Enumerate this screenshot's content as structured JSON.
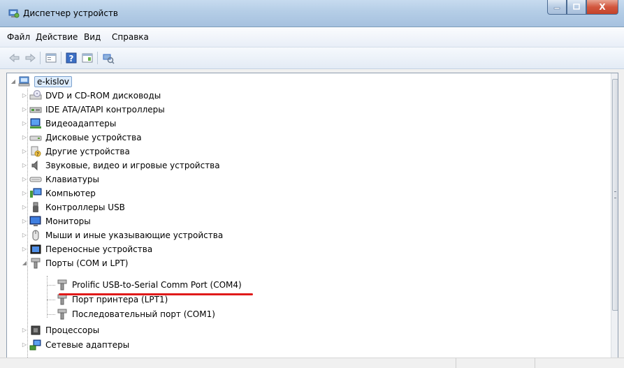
{
  "window": {
    "title": "Диспетчер устройств",
    "icon": "device-manager-icon",
    "controls": {
      "minimize": "–",
      "maximize": "□",
      "close": "X"
    }
  },
  "menu": {
    "items": [
      "Файл",
      "Действие",
      "Вид",
      "Справка"
    ]
  },
  "toolbar": {
    "icons": [
      "back-arrow-icon",
      "forward-arrow-icon",
      "properties-icon",
      "help-icon",
      "view-icon",
      "scan-hardware-icon"
    ]
  },
  "tree": {
    "root": {
      "label": "e-kislov",
      "expanded": true,
      "icon": "computer-icon"
    },
    "items": [
      {
        "label": "DVD и CD-ROM дисководы",
        "icon": "dvd-drive-icon",
        "expanded": false
      },
      {
        "label": "IDE ATA/ATAPI контроллеры",
        "icon": "ide-controller-icon",
        "expanded": false
      },
      {
        "label": "Видеоадаптеры",
        "icon": "display-adapter-icon",
        "expanded": false
      },
      {
        "label": "Дисковые устройства",
        "icon": "disk-drive-icon",
        "expanded": false
      },
      {
        "label": "Другие устройства",
        "icon": "unknown-device-icon",
        "expanded": false
      },
      {
        "label": "Звуковые, видео и игровые устройства",
        "icon": "speaker-icon",
        "expanded": false
      },
      {
        "label": "Клавиатуры",
        "icon": "keyboard-icon",
        "expanded": false
      },
      {
        "label": "Компьютер",
        "icon": "computer-icon",
        "expanded": false
      },
      {
        "label": "Контроллеры USB",
        "icon": "usb-icon",
        "expanded": false
      },
      {
        "label": "Мониторы",
        "icon": "monitor-icon",
        "expanded": false
      },
      {
        "label": "Мыши и иные указывающие устройства",
        "icon": "mouse-icon",
        "expanded": false
      },
      {
        "label": "Переносные устройства",
        "icon": "portable-device-icon",
        "expanded": false
      },
      {
        "label": "Порты (COM и LPT)",
        "icon": "port-icon",
        "expanded": true
      },
      {
        "label": "Prolific USB-to-Serial Comm Port (COM4)",
        "icon": "port-icon",
        "child": true
      },
      {
        "label": "Порт принтера (LPT1)",
        "icon": "port-icon",
        "child": true
      },
      {
        "label": "Последовательный порт (COM1)",
        "icon": "port-icon",
        "child": true
      },
      {
        "label": "Процессоры",
        "icon": "processor-icon",
        "expanded": false
      },
      {
        "label": "Сетевые адаптеры",
        "icon": "network-adapter-icon",
        "expanded": false
      }
    ]
  },
  "colors": {
    "highlight_underline": "#e01a1a",
    "selection_fill": "#dcebfc"
  }
}
